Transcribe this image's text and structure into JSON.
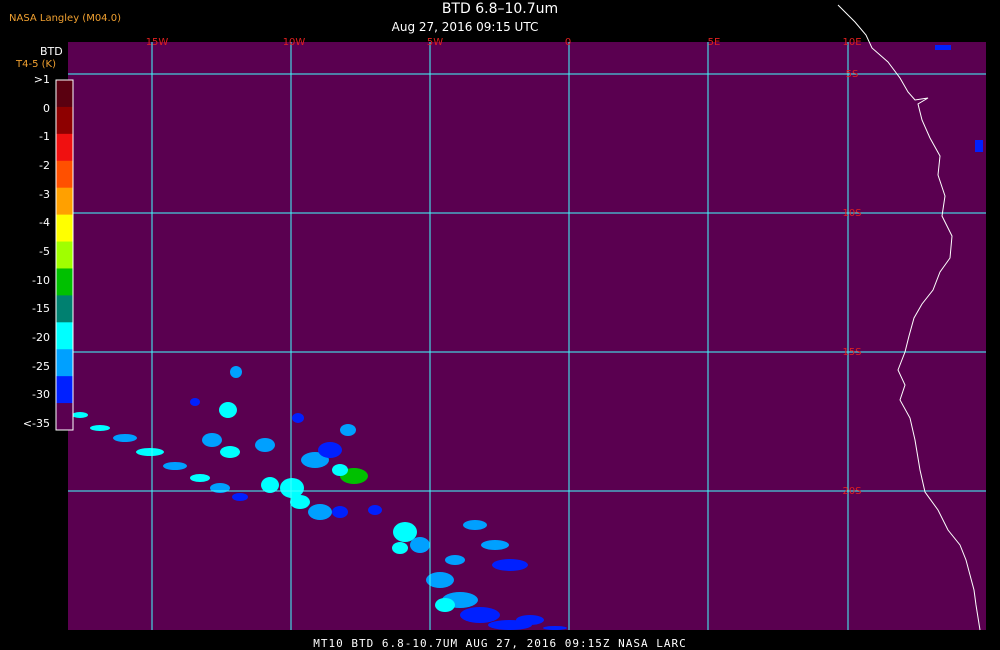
{
  "header": {
    "org_label": "NASA Langley (M04.0)",
    "title": "BTD 6.8–10.7um",
    "subtitle": "Aug 27, 2016 09:15 UTC"
  },
  "colorbar": {
    "title": "BTD",
    "units": "T4-5 (K)",
    "labels": [
      ">1",
      "0",
      "-1",
      "-2",
      "-3",
      "-4",
      "-5",
      "-10",
      "-15",
      "-20",
      "-25",
      "-30",
      "<-35"
    ],
    "colors": [
      "#5a0010",
      "#8e0000",
      "#f01010",
      "#ff5000",
      "#ffa000",
      "#ffff00",
      "#a0ff00",
      "#00c000",
      "#008070",
      "#00ffff",
      "#00a0ff",
      "#0020ff",
      "#5a0050"
    ]
  },
  "map": {
    "background_color": "#5a0050",
    "grid_color": "#40ffff",
    "coast_color": "#ffffff",
    "lon_labels": [
      "15W",
      "10W",
      "5W",
      "0",
      "5E",
      "10E"
    ],
    "lat_labels": [
      "5S",
      "10S",
      "15S",
      "20S"
    ],
    "label_color": "#e02020"
  },
  "footer": {
    "text": "MT10  BTD 6.8-10.7UM   AUG 27, 2016 09:15Z   NASA LARC"
  }
}
